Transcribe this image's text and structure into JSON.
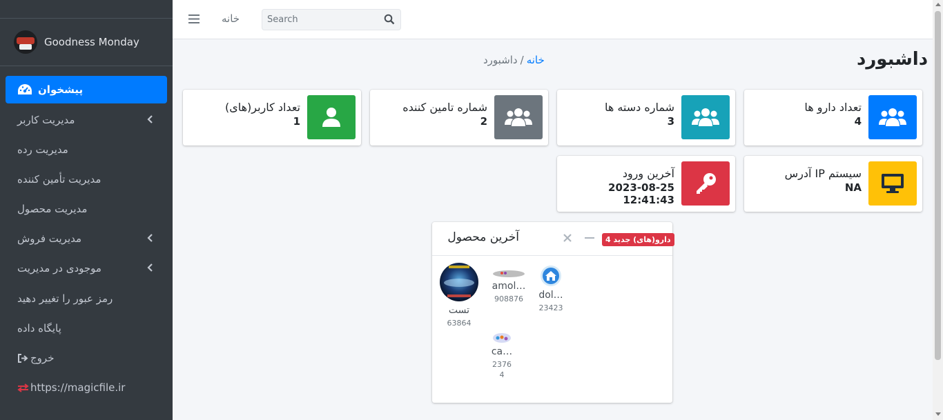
{
  "sidebar": {
    "brand": "Goodness Monday",
    "active_item": "پیشخوان",
    "items": [
      {
        "label": "مدیریت کاربر"
      },
      {
        "label": "مدیریت رده"
      },
      {
        "label": "مدیریت تأمین کننده"
      },
      {
        "label": "مدیریت محصول"
      },
      {
        "label": "مدیریت فروش"
      },
      {
        "label": "موجودی در مدیریت"
      },
      {
        "label": "رمز عبور را تغییر دهید"
      },
      {
        "label": "پایگاه داده"
      },
      {
        "label": "خروج"
      },
      {
        "label": "https://magicfile.ir"
      }
    ]
  },
  "topbar": {
    "home_link": "خانه",
    "search": {
      "placeholder": "Search",
      "value": ""
    }
  },
  "header": {
    "title": "داشبورد",
    "breadcrumb": {
      "home": "خانه",
      "separator": "/",
      "current": "داشبورد"
    }
  },
  "info_boxes": [
    {
      "label": "تعداد دارو ها",
      "value": "4",
      "color": "#007bff",
      "icon": "users-icon"
    },
    {
      "label": "شماره دسته ها",
      "value": "3",
      "color": "#17a2b8",
      "icon": "users-icon"
    },
    {
      "label": "شماره تامین کننده",
      "value": "2",
      "color": "#6c757d",
      "icon": "users-icon"
    },
    {
      "label": "تعداد کاربر(های)",
      "value": "1",
      "color": "#28a745",
      "icon": "user-icon"
    },
    {
      "label": "آدرس IP سیستم",
      "value": "NA",
      "color": "#ffc107",
      "icon": "desktop-icon"
    },
    {
      "label": "آخرین ورود",
      "value": "2023-08-25 12:41:43",
      "color": "#dc3545",
      "icon": "key-icon"
    }
  ],
  "latest_products": {
    "title": "آخرین محصول",
    "badge": "4 دارو(های) جدید",
    "products": [
      {
        "name": "تست",
        "price": "63864"
      },
      {
        "name": "amol…",
        "price": "908876"
      },
      {
        "name": "dol…",
        "price": "23423"
      },
      {
        "name": "ca…",
        "price_line1": "2376",
        "price_line2": "4"
      }
    ]
  }
}
